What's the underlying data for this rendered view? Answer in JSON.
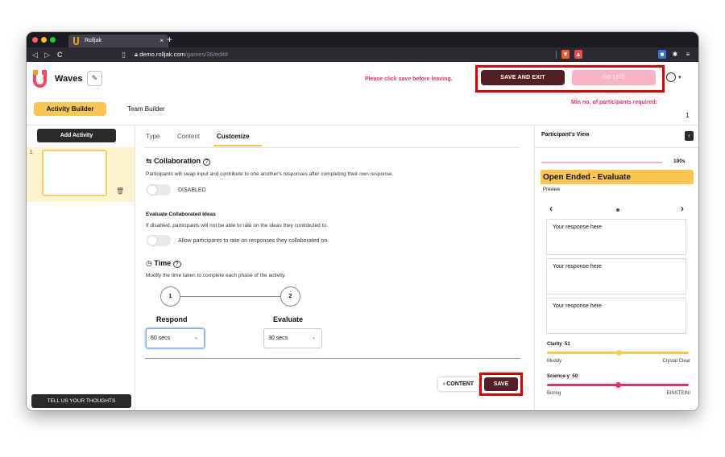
{
  "browser": {
    "tab_title": "Rolljak",
    "tab_close": "×",
    "new_tab": "+",
    "url_host": "demo.rolljak.com",
    "url_path": "/games/36/edit#",
    "nav_back": "◁",
    "nav_forward": "▷",
    "nav_reload": "C"
  },
  "header": {
    "game_title": "Waves",
    "edit_icon": "✎",
    "warning": "Please click save before leaving.",
    "save_exit_label": "SAVE AND EXIT",
    "go_live_label": "GO LIVE",
    "min_participants_label": "Min no. of participants required:",
    "min_participants_value": "1"
  },
  "top_tabs": {
    "activity_builder": "Activity Builder",
    "team_builder": "Team Builder"
  },
  "sidebar": {
    "add_activity": "Add Activity",
    "slides": [
      {
        "number": "1."
      }
    ],
    "feedback_button": "TELL US YOUR THOUGHTS"
  },
  "main": {
    "tabs": [
      {
        "label": "Type"
      },
      {
        "label": "Content"
      },
      {
        "label": "Customize",
        "active": true
      }
    ],
    "collaboration": {
      "title": "Collaboration",
      "help": "?",
      "description": "Participants will swap input and contribute to one another's responses after completing their own response.",
      "toggle_label": "DISABLED"
    },
    "evaluate": {
      "title": "Evaluate Collaborated Ideas",
      "description": "If disabled, participants will not be able to rate on the ideas they contributed to.",
      "toggle_label": "Allow participants to rate on responses they collaborated on."
    },
    "time": {
      "title": "Time",
      "help": "?",
      "description": "Modify the time taken to complete each phase of the activity.",
      "phases": [
        {
          "step": "1",
          "label": "Respond",
          "value": "60 secs"
        },
        {
          "step": "2",
          "label": "Evaluate",
          "value": "30 secs"
        }
      ]
    },
    "content_button": "‹ CONTENT",
    "save_button": "SAVE"
  },
  "preview": {
    "title": "Participant's View",
    "collapse": "‹",
    "timer": "100s",
    "question_type": "Open Ended - Evaluate",
    "mode": "Preview",
    "prev": "‹",
    "next": "›",
    "responses": [
      "Your response here",
      "Your response here",
      "Your response here"
    ],
    "sliders": [
      {
        "label": "Clarity",
        "value": "51",
        "level_pct": 51,
        "min_label": "Muddy",
        "max_label": "Crystal Clear",
        "color": "#f9c74f"
      },
      {
        "label": "Science-y",
        "value": "50",
        "level_pct": 50,
        "min_label": "Boring",
        "max_label": "EINSTEIN!",
        "color": "#e5306f"
      }
    ]
  },
  "colors": {
    "accent_yellow": "#f9c74f",
    "brand_pink": "#e5306f",
    "dark_maroon": "#531f22",
    "highlight_red": "#e00000"
  }
}
